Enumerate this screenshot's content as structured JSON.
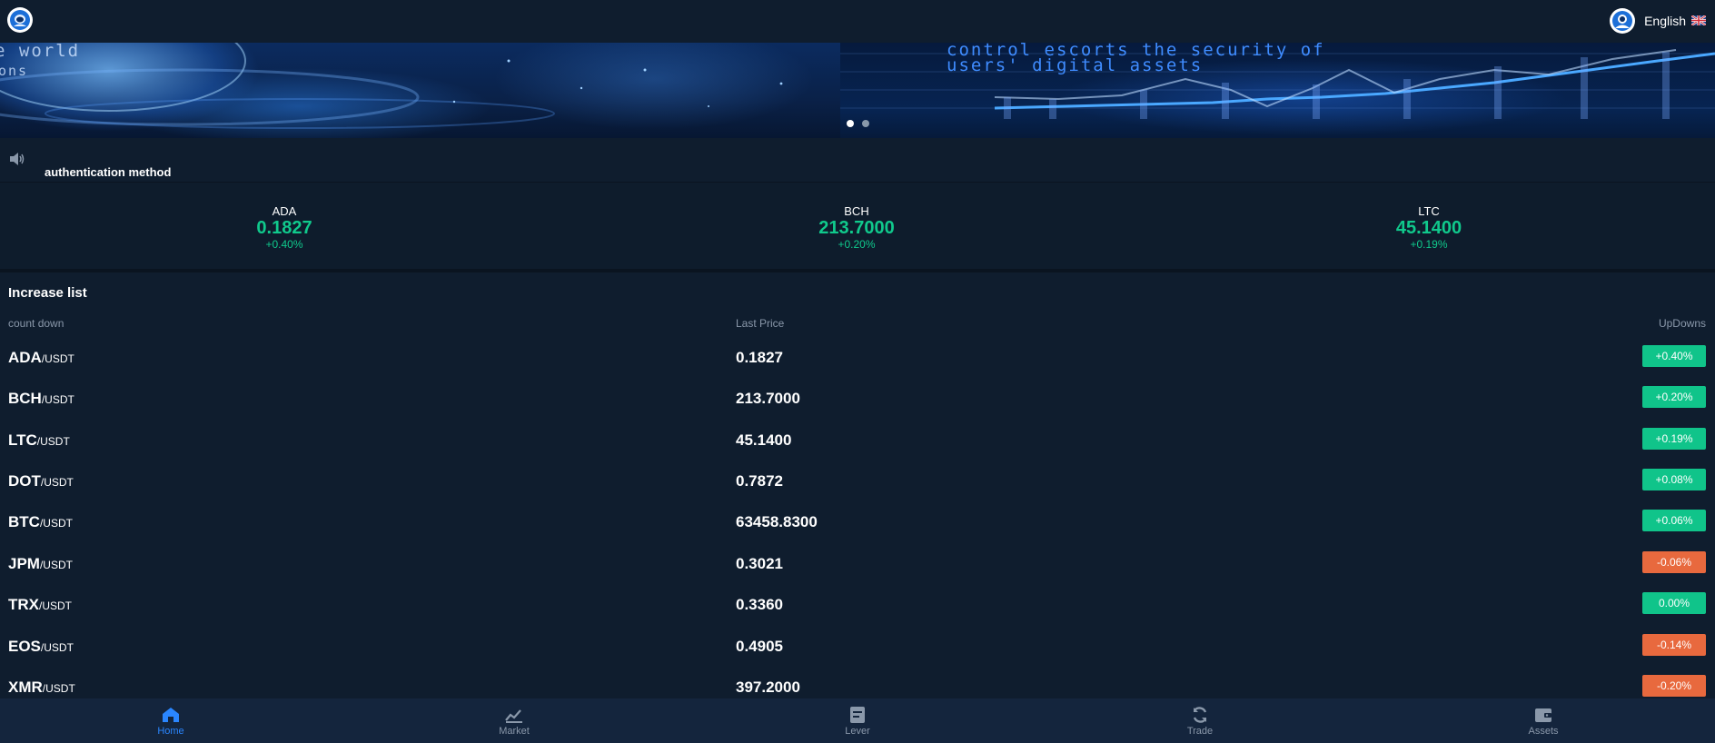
{
  "header": {
    "language_label": "English",
    "logo_icon": "astronaut-logo-icon",
    "avatar_icon": "user-avatar-icon",
    "flag_icon": "uk-flag-icon"
  },
  "banner": {
    "left_text_1": "e world",
    "left_text_2": "ons",
    "right_text_1": "control escorts the security of",
    "right_text_2": "users' digital assets",
    "slide_count": 2,
    "active_slide": 1
  },
  "notice": {
    "icon": "speaker-icon",
    "text": "authentication method"
  },
  "ticker": [
    {
      "symbol": "ADA",
      "price": "0.1827",
      "change": "+0.40%"
    },
    {
      "symbol": "BCH",
      "price": "213.7000",
      "change": "+0.20%"
    },
    {
      "symbol": "LTC",
      "price": "45.1400",
      "change": "+0.19%"
    }
  ],
  "list": {
    "title": "Increase list",
    "col_name": "count down",
    "col_price": "Last Price",
    "col_change": "UpDowns",
    "rows": [
      {
        "base": "ADA",
        "quote": "/USDT",
        "price": "0.1827",
        "change": "+0.40%",
        "dir": "up"
      },
      {
        "base": "BCH",
        "quote": "/USDT",
        "price": "213.7000",
        "change": "+0.20%",
        "dir": "up"
      },
      {
        "base": "LTC",
        "quote": "/USDT",
        "price": "45.1400",
        "change": "+0.19%",
        "dir": "up"
      },
      {
        "base": "DOT",
        "quote": "/USDT",
        "price": "0.7872",
        "change": "+0.08%",
        "dir": "up"
      },
      {
        "base": "BTC",
        "quote": "/USDT",
        "price": "63458.8300",
        "change": "+0.06%",
        "dir": "up"
      },
      {
        "base": "JPM",
        "quote": "/USDT",
        "price": "0.3021",
        "change": "-0.06%",
        "dir": "down"
      },
      {
        "base": "TRX",
        "quote": "/USDT",
        "price": "0.3360",
        "change": "0.00%",
        "dir": "up"
      },
      {
        "base": "EOS",
        "quote": "/USDT",
        "price": "0.4905",
        "change": "-0.14%",
        "dir": "down"
      },
      {
        "base": "XMR",
        "quote": "/USDT",
        "price": "397.2000",
        "change": "-0.20%",
        "dir": "down"
      }
    ]
  },
  "tabs": [
    {
      "label": "Home",
      "icon": "home-icon",
      "active": true
    },
    {
      "label": "Market",
      "icon": "market-icon",
      "active": false
    },
    {
      "label": "Lever",
      "icon": "lever-icon",
      "active": false
    },
    {
      "label": "Trade",
      "icon": "trade-icon",
      "active": false
    },
    {
      "label": "Assets",
      "icon": "wallet-icon",
      "active": false
    }
  ],
  "colors": {
    "background": "#0f1d2e",
    "up": "#10c48a",
    "down": "#e8693e",
    "accent": "#2a86ff",
    "muted": "#8a98aa"
  }
}
